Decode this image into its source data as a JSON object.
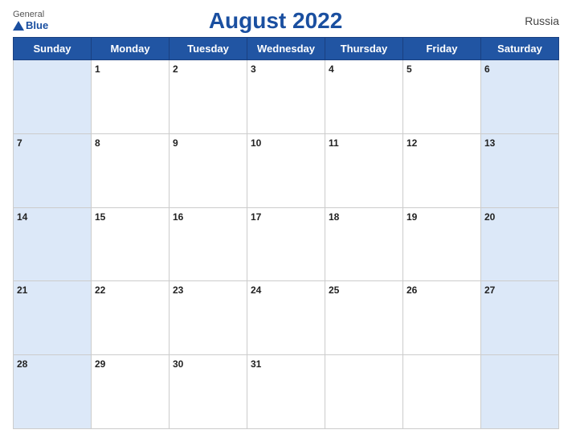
{
  "header": {
    "logo_general": "General",
    "logo_blue": "Blue",
    "title": "August 2022",
    "country": "Russia"
  },
  "weekdays": [
    "Sunday",
    "Monday",
    "Tuesday",
    "Wednesday",
    "Thursday",
    "Friday",
    "Saturday"
  ],
  "weeks": [
    [
      {
        "day": "",
        "shade": true
      },
      {
        "day": "1",
        "shade": false
      },
      {
        "day": "2",
        "shade": false
      },
      {
        "day": "3",
        "shade": false
      },
      {
        "day": "4",
        "shade": false
      },
      {
        "day": "5",
        "shade": false
      },
      {
        "day": "6",
        "shade": true
      }
    ],
    [
      {
        "day": "7",
        "shade": true
      },
      {
        "day": "8",
        "shade": false
      },
      {
        "day": "9",
        "shade": false
      },
      {
        "day": "10",
        "shade": false
      },
      {
        "day": "11",
        "shade": false
      },
      {
        "day": "12",
        "shade": false
      },
      {
        "day": "13",
        "shade": true
      }
    ],
    [
      {
        "day": "14",
        "shade": true
      },
      {
        "day": "15",
        "shade": false
      },
      {
        "day": "16",
        "shade": false
      },
      {
        "day": "17",
        "shade": false
      },
      {
        "day": "18",
        "shade": false
      },
      {
        "day": "19",
        "shade": false
      },
      {
        "day": "20",
        "shade": true
      }
    ],
    [
      {
        "day": "21",
        "shade": true
      },
      {
        "day": "22",
        "shade": false
      },
      {
        "day": "23",
        "shade": false
      },
      {
        "day": "24",
        "shade": false
      },
      {
        "day": "25",
        "shade": false
      },
      {
        "day": "26",
        "shade": false
      },
      {
        "day": "27",
        "shade": true
      }
    ],
    [
      {
        "day": "28",
        "shade": true
      },
      {
        "day": "29",
        "shade": false
      },
      {
        "day": "30",
        "shade": false
      },
      {
        "day": "31",
        "shade": false
      },
      {
        "day": "",
        "shade": false
      },
      {
        "day": "",
        "shade": false
      },
      {
        "day": "",
        "shade": true
      }
    ]
  ]
}
